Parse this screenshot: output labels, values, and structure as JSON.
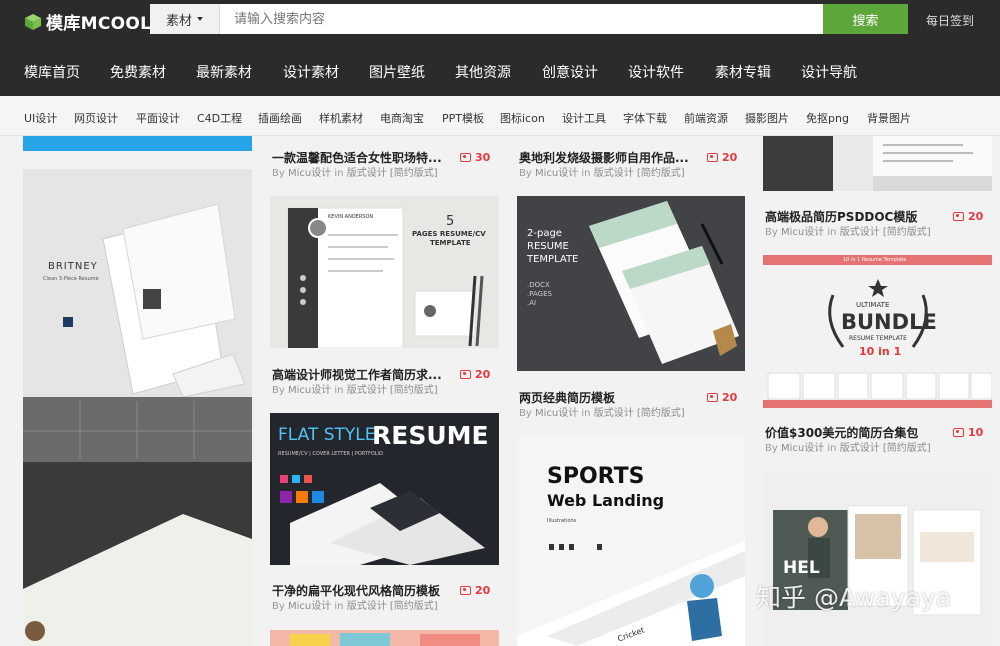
{
  "header": {
    "logo_text": "模库MCOOL",
    "search_category": "素材",
    "search_placeholder": "请输入搜索内容",
    "search_button": "搜索",
    "signin": "每日签到"
  },
  "main_nav": [
    "模库首页",
    "免费素材",
    "最新素材",
    "设计素材",
    "图片壁纸",
    "其他资源",
    "创意设计",
    "设计软件",
    "素材专辑",
    "设计导航"
  ],
  "sub_nav": [
    "UI设计",
    "网页设计",
    "平面设计",
    "C4D工程",
    "插画绘画",
    "样机素材",
    "电商淘宝",
    "PPT模板",
    "图标icon",
    "设计工具",
    "字体下载",
    "前端资源",
    "摄影图片",
    "免抠png",
    "背景图片"
  ],
  "meta": {
    "by": "By",
    "author": "Micu设计",
    "in": "in",
    "category": "版式设计",
    "tag": "[简约版式]"
  },
  "cards": [
    {
      "title": "一款温馨配色适合女性职场特...",
      "count": "30"
    },
    {
      "title": "奥地利发烧级摄影师自用作品...",
      "count": "20"
    },
    {
      "title": "高端极品简历PSDDOC模版",
      "count": "20"
    },
    {
      "title": "高端设计师视觉工作者简历求...",
      "count": "20"
    },
    {
      "title": "两页经典简历模板",
      "count": "20"
    },
    {
      "title": "价值$300美元的简历合集包",
      "count": "10"
    },
    {
      "title": "干净的扁平化现代风格简历模板",
      "count": "20"
    }
  ],
  "thumbs": {
    "britney": {
      "name": "BRITNEY",
      "sub": "Clean 3-Piece Resume"
    },
    "kevin": {
      "num": "5",
      "line1": "PAGES RESUME/CV",
      "line2": "TEMPLATE",
      "name": "KEVIN ANDERSON"
    },
    "twopage": {
      "l1": "2-page",
      "l2": "RESUME",
      "l3": "TEMPLATE",
      "f1": ".DOCX",
      "f2": ".PAGES",
      "f3": ".AI"
    },
    "bundle": {
      "top": "10 in 1 Resume Template",
      "ultimate": "ULTIMATE",
      "bundle": "BUNDLE",
      "resume": "RESUME TEMPLATE",
      "tenin": "10 in 1"
    },
    "flat": {
      "flat": "FLAT STYLE",
      "resume": "RESUME",
      "sub": "RESUME/CV | COVER LETTER | PORTFOLIO"
    },
    "sports": {
      "l1": "SPORTS",
      "l2": "Web Landing",
      "l3": "Illustrations",
      "cricket": "Cricket"
    },
    "insta": {
      "hel": "HEL"
    }
  },
  "watermark": "知乎 @Awayaya",
  "colors": {
    "topbar": "#2b2b2b",
    "search_button": "#5da63a",
    "badge": "#e0393e"
  }
}
